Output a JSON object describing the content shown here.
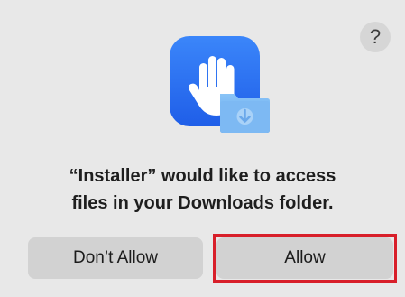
{
  "dialog": {
    "help_label": "?",
    "message_line1": "“Installer” would like to access",
    "message_line2": "files in your Downloads folder.",
    "deny_label": "Don’t Allow",
    "allow_label": "Allow",
    "icons": {
      "app": "privacy-hand-icon",
      "folder": "downloads-folder-icon",
      "help": "question-mark-icon"
    },
    "colors": {
      "background": "#e8e8e8",
      "icon_blue": "#2f6cf0",
      "folder_blue": "#78b5f2",
      "highlight": "#d81f2a"
    }
  }
}
